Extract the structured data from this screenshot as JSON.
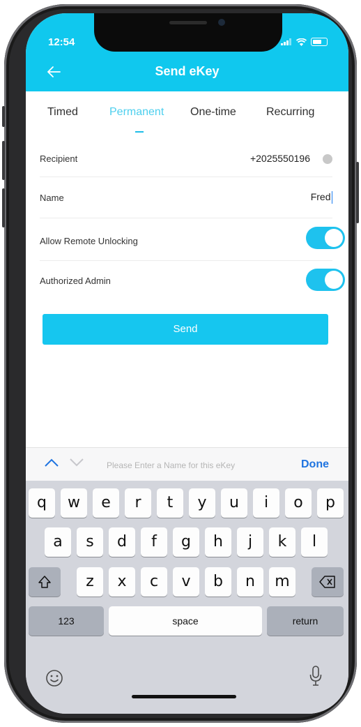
{
  "status": {
    "time": "12:54"
  },
  "header": {
    "title": "Send eKey",
    "back_icon": "arrow-left-icon"
  },
  "tabs": [
    {
      "label": "Timed",
      "active": false
    },
    {
      "label": "Permanent",
      "active": true
    },
    {
      "label": "One-time",
      "active": false
    },
    {
      "label": "Recurring",
      "active": false
    }
  ],
  "form": {
    "recipient": {
      "label": "Recipient",
      "value": "+2025550196"
    },
    "name": {
      "label": "Name",
      "value": "Fred"
    },
    "remote_unlocking": {
      "label": "Allow Remote Unlocking",
      "on": true
    },
    "authorized_admin": {
      "label": "Authorized Admin",
      "on": true
    }
  },
  "send_button": {
    "label": "Send"
  },
  "keyboard_toolbar": {
    "hint": "Please Enter a Name for this eKey",
    "done": "Done"
  },
  "keyboard": {
    "row1": [
      "q",
      "w",
      "e",
      "r",
      "t",
      "y",
      "u",
      "i",
      "o",
      "p"
    ],
    "row2": [
      "a",
      "s",
      "d",
      "f",
      "g",
      "h",
      "j",
      "k",
      "l"
    ],
    "row3": [
      "z",
      "x",
      "c",
      "v",
      "b",
      "n",
      "m"
    ],
    "numbers_label": "123",
    "space_label": "space",
    "return_label": "return"
  },
  "colors": {
    "accent": "#10c8ee",
    "done": "#1f74e0"
  }
}
